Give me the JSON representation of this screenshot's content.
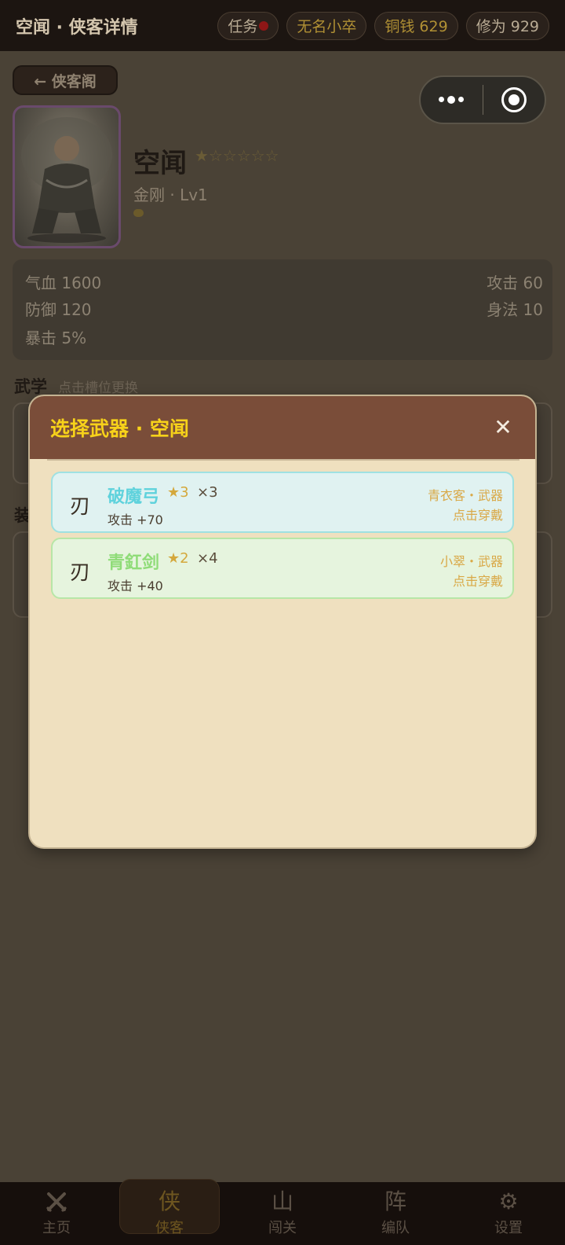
{
  "header": {
    "title": "空闻 · 侠客详情",
    "task_label": "任务",
    "rank": "无名小卒",
    "coins": "铜钱 629",
    "cultivation": "修为 929"
  },
  "back_label": "← 侠客阁",
  "hero": {
    "name": "空闻",
    "stars": "★☆☆☆☆☆",
    "subtitle": "金刚 · Lv1"
  },
  "stats": {
    "hp": "气血 1600",
    "attack": "攻击 60",
    "defense": "防御 120",
    "agility": "身法 10",
    "crit": "暴击 5%"
  },
  "martial": {
    "title": "武学",
    "hint": "点击槽位更换"
  },
  "equipment": {
    "title": "装"
  },
  "modal": {
    "title": "选择武器 · 空闻",
    "close": "✕",
    "weapons": [
      {
        "icon": "刃",
        "name": "破魔弓",
        "stars": "★3",
        "count": "×3",
        "stat": "攻击 +70",
        "owner": "青衣客・武器",
        "action": "点击穿戴",
        "rarity_color": "#5fd2dc"
      },
      {
        "icon": "刃",
        "name": "青釭剑",
        "stars": "★2",
        "count": "×4",
        "stat": "攻击 +40",
        "owner": "小翠・武器",
        "action": "点击穿戴",
        "rarity_color": "#8fdc78"
      }
    ]
  },
  "tabs": [
    {
      "icon": "crossed-swords-icon",
      "label": "主页"
    },
    {
      "icon": "侠",
      "label": "侠客"
    },
    {
      "icon": "山",
      "label": "闯关"
    },
    {
      "icon": "阵",
      "label": "编队"
    },
    {
      "icon": "gear-icon",
      "label": "设置"
    }
  ]
}
